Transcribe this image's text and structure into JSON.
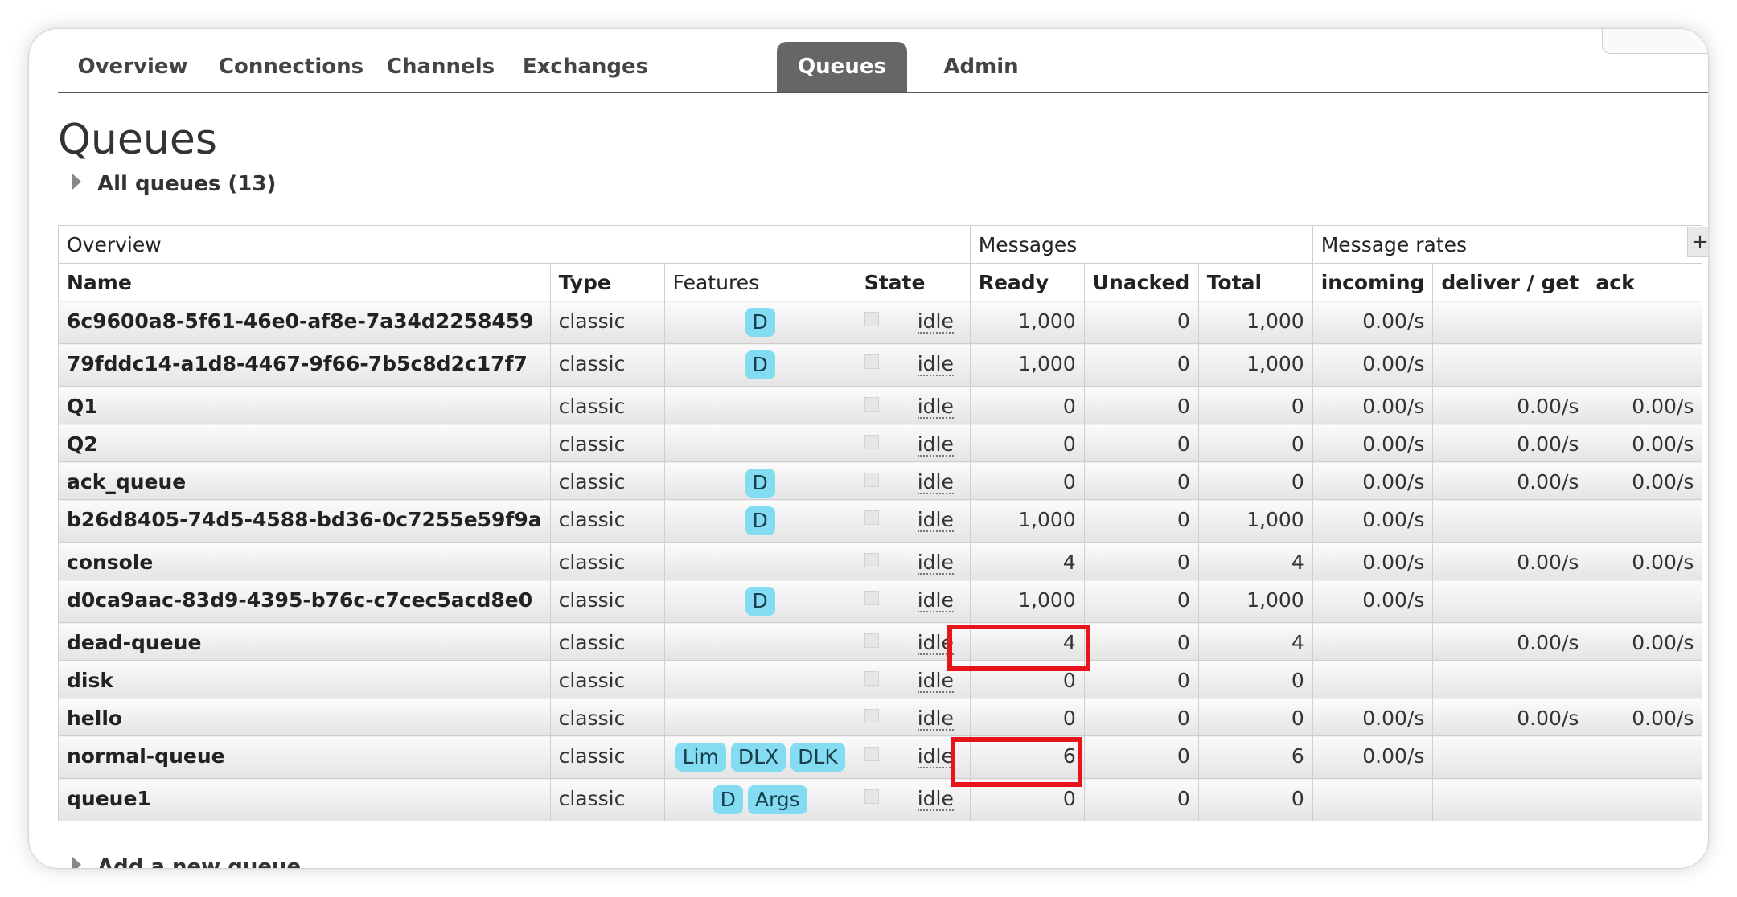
{
  "nav": {
    "tabs": [
      {
        "label": "Overview"
      },
      {
        "label": "Connections"
      },
      {
        "label": "Channels"
      },
      {
        "label": "Exchanges"
      },
      {
        "label": "Queues",
        "active": true
      },
      {
        "label": "Admin"
      }
    ]
  },
  "page": {
    "title": "Queues",
    "all_queues_toggle": "All queues (13)",
    "add_queue_toggle": "Add a new queue",
    "expand_columns_label": "+"
  },
  "table": {
    "group_headers": [
      "Overview",
      "Messages",
      "Message rates"
    ],
    "columns": [
      "Name",
      "Type",
      "Features",
      "State",
      "Ready",
      "Unacked",
      "Total",
      "incoming",
      "deliver / get",
      "ack"
    ],
    "rows": [
      {
        "name": "6c9600a8-5f61-46e0-af8e-7a34d2258459",
        "type": "classic",
        "features": [
          "D"
        ],
        "state": "idle",
        "ready": "1,000",
        "unacked": "0",
        "total": "1,000",
        "incoming": "0.00/s",
        "deliver_get": "",
        "ack": ""
      },
      {
        "name": "79fddc14-a1d8-4467-9f66-7b5c8d2c17f7",
        "type": "classic",
        "features": [
          "D"
        ],
        "state": "idle",
        "ready": "1,000",
        "unacked": "0",
        "total": "1,000",
        "incoming": "0.00/s",
        "deliver_get": "",
        "ack": ""
      },
      {
        "name": "Q1",
        "type": "classic",
        "features": [],
        "state": "idle",
        "ready": "0",
        "unacked": "0",
        "total": "0",
        "incoming": "0.00/s",
        "deliver_get": "0.00/s",
        "ack": "0.00/s"
      },
      {
        "name": "Q2",
        "type": "classic",
        "features": [],
        "state": "idle",
        "ready": "0",
        "unacked": "0",
        "total": "0",
        "incoming": "0.00/s",
        "deliver_get": "0.00/s",
        "ack": "0.00/s"
      },
      {
        "name": "ack_queue",
        "type": "classic",
        "features": [
          "D"
        ],
        "state": "idle",
        "ready": "0",
        "unacked": "0",
        "total": "0",
        "incoming": "0.00/s",
        "deliver_get": "0.00/s",
        "ack": "0.00/s"
      },
      {
        "name": "b26d8405-74d5-4588-bd36-0c7255e59f9a",
        "type": "classic",
        "features": [
          "D"
        ],
        "state": "idle",
        "ready": "1,000",
        "unacked": "0",
        "total": "1,000",
        "incoming": "0.00/s",
        "deliver_get": "",
        "ack": ""
      },
      {
        "name": "console",
        "type": "classic",
        "features": [],
        "state": "idle",
        "ready": "4",
        "unacked": "0",
        "total": "4",
        "incoming": "0.00/s",
        "deliver_get": "0.00/s",
        "ack": "0.00/s"
      },
      {
        "name": "d0ca9aac-83d9-4395-b76c-c7cec5acd8e0",
        "type": "classic",
        "features": [
          "D"
        ],
        "state": "idle",
        "ready": "1,000",
        "unacked": "0",
        "total": "1,000",
        "incoming": "0.00/s",
        "deliver_get": "",
        "ack": ""
      },
      {
        "name": "dead-queue",
        "type": "classic",
        "features": [],
        "state": "idle",
        "ready": "4",
        "unacked": "0",
        "total": "4",
        "incoming": "",
        "deliver_get": "0.00/s",
        "ack": "0.00/s"
      },
      {
        "name": "disk",
        "type": "classic",
        "features": [],
        "state": "idle",
        "ready": "0",
        "unacked": "0",
        "total": "0",
        "incoming": "",
        "deliver_get": "",
        "ack": ""
      },
      {
        "name": "hello",
        "type": "classic",
        "features": [],
        "state": "idle",
        "ready": "0",
        "unacked": "0",
        "total": "0",
        "incoming": "0.00/s",
        "deliver_get": "0.00/s",
        "ack": "0.00/s"
      },
      {
        "name": "normal-queue",
        "type": "classic",
        "features": [
          "Lim",
          "DLX",
          "DLK"
        ],
        "state": "idle",
        "ready": "6",
        "unacked": "0",
        "total": "6",
        "incoming": "0.00/s",
        "deliver_get": "",
        "ack": ""
      },
      {
        "name": "queue1",
        "type": "classic",
        "features": [
          "D",
          "Args"
        ],
        "state": "idle",
        "ready": "0",
        "unacked": "0",
        "total": "0",
        "incoming": "",
        "deliver_get": "",
        "ack": ""
      }
    ]
  },
  "colors": {
    "active_tab_bg": "#666666",
    "feature_badge_bg": "#84dcf2",
    "highlight_border": "#e8141b"
  }
}
